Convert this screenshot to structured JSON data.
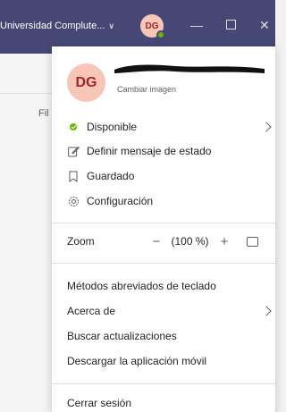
{
  "titlebar": {
    "org_name": "Universidad Complute...",
    "avatar_initials": "DG"
  },
  "background": {
    "truncated_label": "Fil"
  },
  "profile": {
    "avatar_initials": "DG",
    "change_image": "Cambiar imagen"
  },
  "status_section": {
    "available": "Disponible",
    "set_status_message": "Definir mensaje de estado",
    "saved": "Guardado",
    "settings": "Configuración"
  },
  "zoom": {
    "label": "Zoom",
    "minus": "−",
    "value": "(100 %)",
    "plus": "+"
  },
  "help_section": {
    "keyboard_shortcuts": "Métodos abreviados de teclado",
    "about": "Acerca de",
    "check_updates": "Buscar actualizaciones",
    "download_mobile": "Descargar la aplicación móvil"
  },
  "footer": {
    "sign_out": "Cerrar sesión"
  },
  "colors": {
    "titlebar": "#464775",
    "available_green": "#6bb700",
    "avatar_bg": "#f7c6b6",
    "avatar_text": "#a4262c"
  },
  "icons": [
    "chevron-down-icon",
    "minimize-icon",
    "maximize-icon",
    "close-icon",
    "status-available-icon",
    "edit-status-icon",
    "bookmark-icon",
    "gear-icon",
    "chevron-right-icon",
    "fullscreen-icon"
  ]
}
